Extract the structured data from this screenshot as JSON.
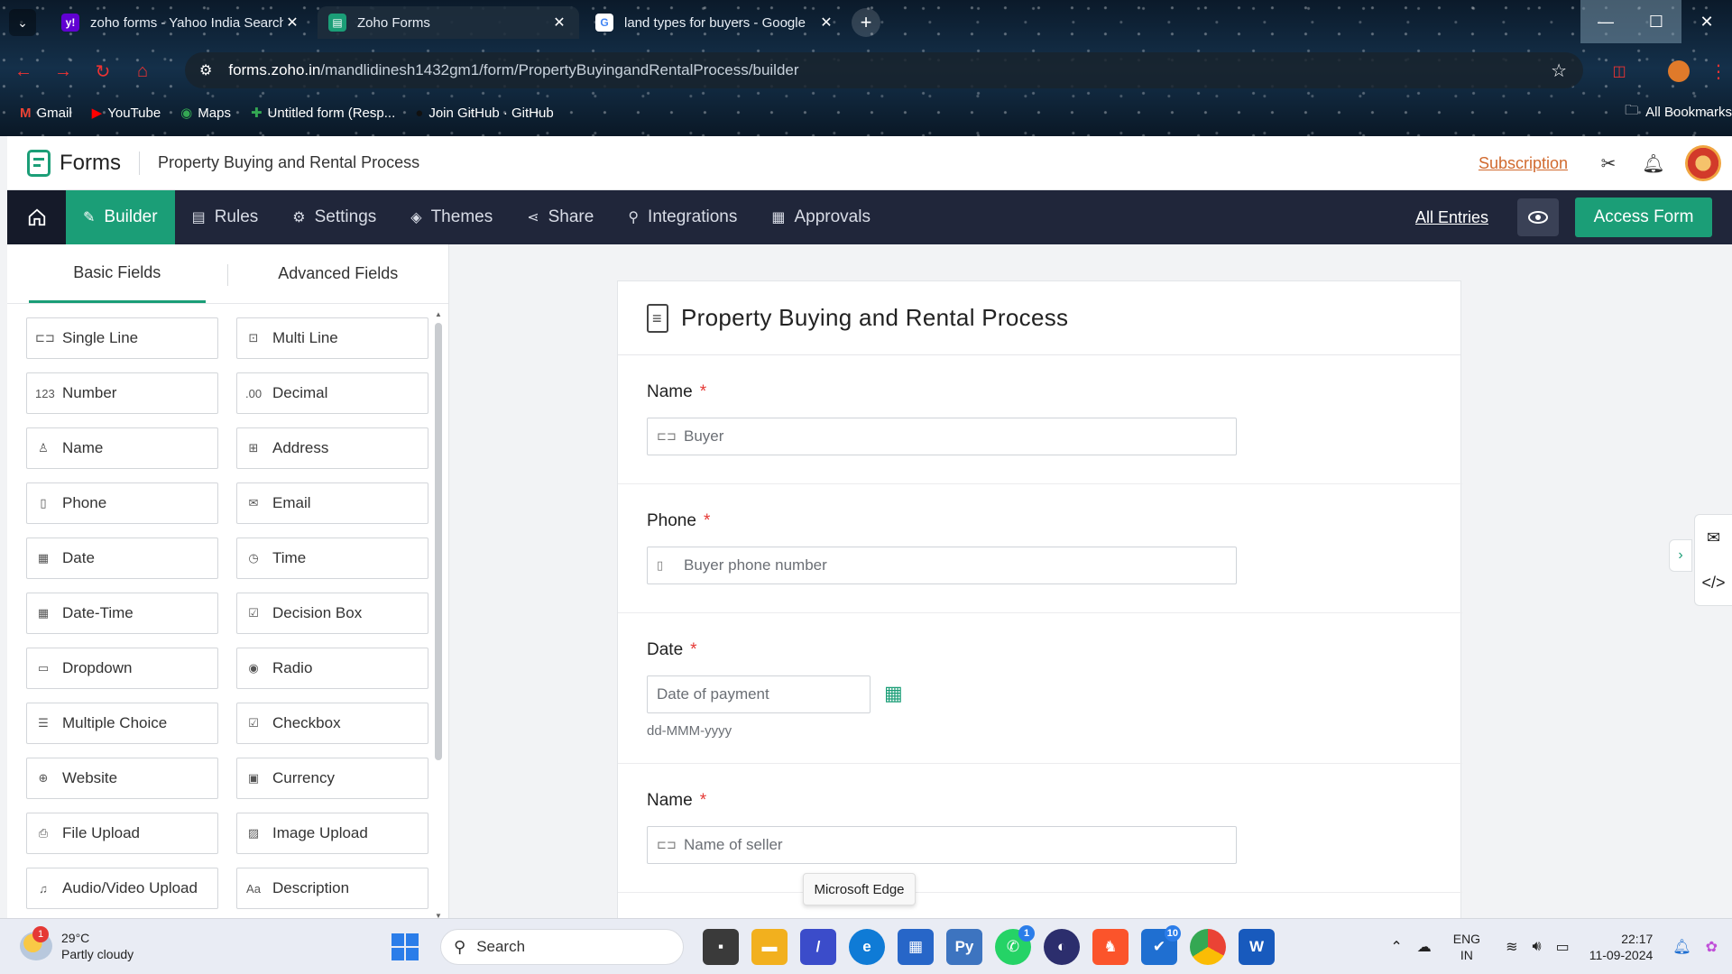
{
  "browser": {
    "tabs": [
      {
        "title": "zoho forms - Yahoo India Search",
        "favicon": "yahoo-icon",
        "active": false
      },
      {
        "title": "Zoho Forms",
        "favicon": "zoho-forms-icon",
        "active": true
      },
      {
        "title": "land types for buyers - Google",
        "favicon": "google-icon",
        "active": false
      }
    ],
    "url_host": "forms.zoho.in",
    "url_path": "/mandlidinesh1432gm1/form/PropertyBuyingandRentalProcess/builder",
    "bookmarks": [
      "Gmail",
      "YouTube",
      "Maps",
      "Untitled form (Resp...",
      "Join GitHub · GitHub"
    ],
    "all_bookmarks": "All Bookmarks"
  },
  "app": {
    "logo_text": "Forms",
    "form_title": "Property Buying and Rental Process",
    "subscription": "Subscription"
  },
  "nav": {
    "items": [
      {
        "label": "Builder",
        "icon": "builder-icon",
        "active": true
      },
      {
        "label": "Rules",
        "icon": "rules-icon"
      },
      {
        "label": "Settings",
        "icon": "settings-icon"
      },
      {
        "label": "Themes",
        "icon": "themes-icon"
      },
      {
        "label": "Share",
        "icon": "share-icon"
      },
      {
        "label": "Integrations",
        "icon": "integrations-icon"
      },
      {
        "label": "Approvals",
        "icon": "approvals-icon"
      }
    ],
    "all_entries": "All Entries",
    "access_form": "Access Form"
  },
  "left_panel": {
    "tabs": [
      "Basic Fields",
      "Advanced Fields"
    ],
    "fields": [
      {
        "label": "Single Line",
        "icon": "⊏⊐"
      },
      {
        "label": "Multi Line",
        "icon": "⊡"
      },
      {
        "label": "Number",
        "icon": "123"
      },
      {
        "label": "Decimal",
        "icon": ".00"
      },
      {
        "label": "Name",
        "icon": "♙"
      },
      {
        "label": "Address",
        "icon": "⊞"
      },
      {
        "label": "Phone",
        "icon": "▯"
      },
      {
        "label": "Email",
        "icon": "✉"
      },
      {
        "label": "Date",
        "icon": "▦"
      },
      {
        "label": "Time",
        "icon": "◷"
      },
      {
        "label": "Date-Time",
        "icon": "▦"
      },
      {
        "label": "Decision Box",
        "icon": "☑"
      },
      {
        "label": "Dropdown",
        "icon": "▭"
      },
      {
        "label": "Radio",
        "icon": "◉"
      },
      {
        "label": "Multiple Choice",
        "icon": "☰"
      },
      {
        "label": "Checkbox",
        "icon": "☑"
      },
      {
        "label": "Website",
        "icon": "⊕"
      },
      {
        "label": "Currency",
        "icon": "▣"
      },
      {
        "label": "File Upload",
        "icon": "⎙"
      },
      {
        "label": "Image Upload",
        "icon": "▨"
      },
      {
        "label": "Audio/Video Upload",
        "icon": "♫"
      },
      {
        "label": "Description",
        "icon": "Aa"
      }
    ]
  },
  "form": {
    "title": "Property Buying and Rental Process",
    "fields": [
      {
        "label": "Name",
        "required": "*",
        "placeholder": "Buyer"
      },
      {
        "label": "Phone",
        "required": "*",
        "placeholder": "Buyer phone number"
      },
      {
        "label": "Date",
        "required": "*",
        "placeholder": "Date of payment",
        "hint": "dd-MMM-yyyy"
      },
      {
        "label": "Name",
        "required": "*",
        "placeholder": "Name of seller"
      }
    ]
  },
  "tooltip": "Microsoft Edge",
  "taskbar": {
    "temperature": "29°C",
    "weather": "Partly cloudy",
    "weather_badge": "1",
    "search": "Search",
    "whatsapp_badge": "1",
    "todo_badge": "10",
    "lang_top": "ENG",
    "lang_bottom": "IN",
    "time": "22:17",
    "date": "11-09-2024"
  }
}
